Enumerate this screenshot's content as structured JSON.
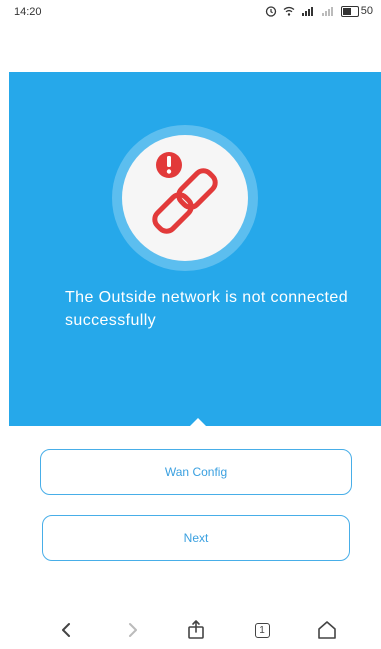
{
  "status_bar": {
    "time": "14:20",
    "battery_level": "50",
    "icons": [
      "alarm-icon",
      "wifi-icon",
      "signal-icon",
      "signal-icon-2",
      "battery-icon"
    ]
  },
  "hero": {
    "background_color": "#26a8ea",
    "message": "The Outside network is not connected successfully",
    "icon": "broken-link-error-icon",
    "icon_color": "#e23a3a"
  },
  "buttons": {
    "wan_config": "Wan Config",
    "next": "Next",
    "accent_color": "#48aee8"
  },
  "navigation": {
    "items": [
      "back-icon",
      "forward-icon",
      "share-icon",
      "tabs-icon",
      "home-icon"
    ],
    "tab_count": "1"
  }
}
